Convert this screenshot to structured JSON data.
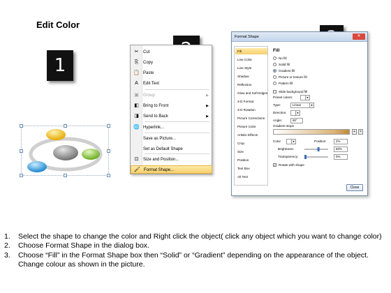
{
  "heading": "Edit Color",
  "steps": {
    "badge1": "1",
    "badge2": "2",
    "badge3": "3"
  },
  "context_menu": {
    "items": [
      {
        "label": "Cut",
        "icon": "scissors-icon",
        "glyph": "✂",
        "disabled": false,
        "submenu": false
      },
      {
        "label": "Copy",
        "icon": "copy-icon",
        "glyph": "⎘",
        "disabled": false,
        "submenu": false
      },
      {
        "label": "Paste",
        "icon": "paste-icon",
        "glyph": "📋",
        "disabled": false,
        "submenu": false
      },
      {
        "label": "Edit Text",
        "icon": "edit-text-icon",
        "glyph": "A",
        "disabled": false,
        "submenu": false
      },
      {
        "label": "Group",
        "icon": "group-icon",
        "glyph": "▣",
        "disabled": true,
        "submenu": true
      },
      {
        "label": "Bring to Front",
        "icon": "bring-to-front-icon",
        "glyph": "◧",
        "disabled": false,
        "submenu": true
      },
      {
        "label": "Send to Back",
        "icon": "send-to-back-icon",
        "glyph": "◨",
        "disabled": false,
        "submenu": true
      },
      {
        "label": "Hyperlink...",
        "icon": "hyperlink-icon",
        "glyph": "🌐",
        "disabled": false,
        "submenu": false
      },
      {
        "label": "Save as Picture...",
        "icon": "",
        "glyph": "",
        "disabled": false,
        "submenu": false
      },
      {
        "label": "Set as Default Shape",
        "icon": "",
        "glyph": "",
        "disabled": false,
        "submenu": false
      },
      {
        "label": "Size and Position...",
        "icon": "size-position-icon",
        "glyph": "⊡",
        "disabled": false,
        "submenu": false
      },
      {
        "label": "Format Shape...",
        "icon": "format-shape-icon",
        "glyph": "🖌",
        "disabled": false,
        "submenu": false,
        "selected": true
      }
    ]
  },
  "dialog": {
    "title": "Format Shape",
    "close_glyph": "✕",
    "sidebar": [
      "Fill",
      "Line Color",
      "Line Style",
      "Shadow",
      "Reflection",
      "Glow and Soft Edges",
      "3-D Format",
      "3-D Rotation",
      "Picture Corrections",
      "Picture Color",
      "Artistic Effects",
      "Crop",
      "Size",
      "Position",
      "Text Box",
      "Alt Text"
    ],
    "section_title": "Fill",
    "fill_options": [
      {
        "label": "No fill",
        "selected": false
      },
      {
        "label": "Solid fill",
        "selected": false
      },
      {
        "label": "Gradient fill",
        "selected": true
      },
      {
        "label": "Picture or texture fill",
        "selected": false
      },
      {
        "label": "Pattern fill",
        "selected": false
      }
    ],
    "slide_background_fill": "Slide background fill",
    "preset_colors_label": "Preset colors:",
    "type_label": "Type:",
    "type_value": "Linear",
    "direction_label": "Direction:",
    "angle_label": "Angle:",
    "angle_value": "90°",
    "gradient_stops_label": "Gradient stops",
    "color_label": "Color",
    "position_label": "Position:",
    "position_value": "2%",
    "brightness_label": "Brightness:",
    "brightness_value": "60%",
    "transparency_label": "Transparency:",
    "transparency_value": "0%",
    "rotate_label": "Rotate with shape",
    "close_button": "Close"
  },
  "instructions": [
    {
      "num": "1.",
      "text": "Select the shape to change the color and Right click the object( click any object which you want to change color)"
    },
    {
      "num": "2.",
      "text": "Choose Format Shape in the dialog box."
    },
    {
      "num": "3.",
      "text": "Choose “Fill” in the Format Shape box then “Solid” or “Gradient” depending on the appearance of the object. Change colour as shown in the picture."
    }
  ],
  "colors": {
    "badge_bg": "#111111",
    "highlight": "#f8cf6a",
    "shape_yellow": "#f5c22b",
    "shape_green": "#8dc63f",
    "shape_blue": "#2f9fe0",
    "shape_gray": "#8a8a8a"
  }
}
